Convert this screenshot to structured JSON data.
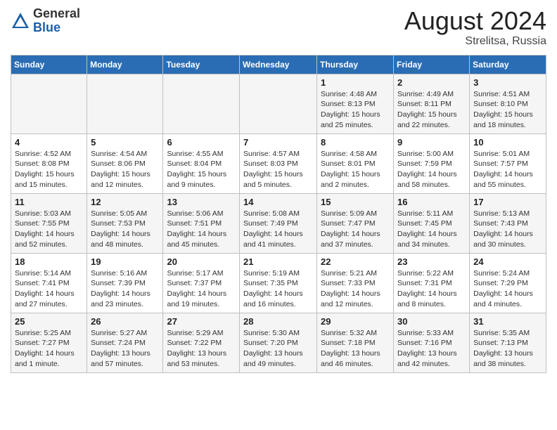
{
  "header": {
    "logo_general": "General",
    "logo_blue": "Blue",
    "month_year": "August 2024",
    "location": "Strelitsa, Russia"
  },
  "calendar": {
    "days_of_week": [
      "Sunday",
      "Monday",
      "Tuesday",
      "Wednesday",
      "Thursday",
      "Friday",
      "Saturday"
    ],
    "weeks": [
      [
        {
          "day": "",
          "detail": ""
        },
        {
          "day": "",
          "detail": ""
        },
        {
          "day": "",
          "detail": ""
        },
        {
          "day": "",
          "detail": ""
        },
        {
          "day": "1",
          "detail": "Sunrise: 4:48 AM\nSunset: 8:13 PM\nDaylight: 15 hours\nand 25 minutes."
        },
        {
          "day": "2",
          "detail": "Sunrise: 4:49 AM\nSunset: 8:11 PM\nDaylight: 15 hours\nand 22 minutes."
        },
        {
          "day": "3",
          "detail": "Sunrise: 4:51 AM\nSunset: 8:10 PM\nDaylight: 15 hours\nand 18 minutes."
        }
      ],
      [
        {
          "day": "4",
          "detail": "Sunrise: 4:52 AM\nSunset: 8:08 PM\nDaylight: 15 hours\nand 15 minutes."
        },
        {
          "day": "5",
          "detail": "Sunrise: 4:54 AM\nSunset: 8:06 PM\nDaylight: 15 hours\nand 12 minutes."
        },
        {
          "day": "6",
          "detail": "Sunrise: 4:55 AM\nSunset: 8:04 PM\nDaylight: 15 hours\nand 9 minutes."
        },
        {
          "day": "7",
          "detail": "Sunrise: 4:57 AM\nSunset: 8:03 PM\nDaylight: 15 hours\nand 5 minutes."
        },
        {
          "day": "8",
          "detail": "Sunrise: 4:58 AM\nSunset: 8:01 PM\nDaylight: 15 hours\nand 2 minutes."
        },
        {
          "day": "9",
          "detail": "Sunrise: 5:00 AM\nSunset: 7:59 PM\nDaylight: 14 hours\nand 58 minutes."
        },
        {
          "day": "10",
          "detail": "Sunrise: 5:01 AM\nSunset: 7:57 PM\nDaylight: 14 hours\nand 55 minutes."
        }
      ],
      [
        {
          "day": "11",
          "detail": "Sunrise: 5:03 AM\nSunset: 7:55 PM\nDaylight: 14 hours\nand 52 minutes."
        },
        {
          "day": "12",
          "detail": "Sunrise: 5:05 AM\nSunset: 7:53 PM\nDaylight: 14 hours\nand 48 minutes."
        },
        {
          "day": "13",
          "detail": "Sunrise: 5:06 AM\nSunset: 7:51 PM\nDaylight: 14 hours\nand 45 minutes."
        },
        {
          "day": "14",
          "detail": "Sunrise: 5:08 AM\nSunset: 7:49 PM\nDaylight: 14 hours\nand 41 minutes."
        },
        {
          "day": "15",
          "detail": "Sunrise: 5:09 AM\nSunset: 7:47 PM\nDaylight: 14 hours\nand 37 minutes."
        },
        {
          "day": "16",
          "detail": "Sunrise: 5:11 AM\nSunset: 7:45 PM\nDaylight: 14 hours\nand 34 minutes."
        },
        {
          "day": "17",
          "detail": "Sunrise: 5:13 AM\nSunset: 7:43 PM\nDaylight: 14 hours\nand 30 minutes."
        }
      ],
      [
        {
          "day": "18",
          "detail": "Sunrise: 5:14 AM\nSunset: 7:41 PM\nDaylight: 14 hours\nand 27 minutes."
        },
        {
          "day": "19",
          "detail": "Sunrise: 5:16 AM\nSunset: 7:39 PM\nDaylight: 14 hours\nand 23 minutes."
        },
        {
          "day": "20",
          "detail": "Sunrise: 5:17 AM\nSunset: 7:37 PM\nDaylight: 14 hours\nand 19 minutes."
        },
        {
          "day": "21",
          "detail": "Sunrise: 5:19 AM\nSunset: 7:35 PM\nDaylight: 14 hours\nand 16 minutes."
        },
        {
          "day": "22",
          "detail": "Sunrise: 5:21 AM\nSunset: 7:33 PM\nDaylight: 14 hours\nand 12 minutes."
        },
        {
          "day": "23",
          "detail": "Sunrise: 5:22 AM\nSunset: 7:31 PM\nDaylight: 14 hours\nand 8 minutes."
        },
        {
          "day": "24",
          "detail": "Sunrise: 5:24 AM\nSunset: 7:29 PM\nDaylight: 14 hours\nand 4 minutes."
        }
      ],
      [
        {
          "day": "25",
          "detail": "Sunrise: 5:25 AM\nSunset: 7:27 PM\nDaylight: 14 hours\nand 1 minute."
        },
        {
          "day": "26",
          "detail": "Sunrise: 5:27 AM\nSunset: 7:24 PM\nDaylight: 13 hours\nand 57 minutes."
        },
        {
          "day": "27",
          "detail": "Sunrise: 5:29 AM\nSunset: 7:22 PM\nDaylight: 13 hours\nand 53 minutes."
        },
        {
          "day": "28",
          "detail": "Sunrise: 5:30 AM\nSunset: 7:20 PM\nDaylight: 13 hours\nand 49 minutes."
        },
        {
          "day": "29",
          "detail": "Sunrise: 5:32 AM\nSunset: 7:18 PM\nDaylight: 13 hours\nand 46 minutes."
        },
        {
          "day": "30",
          "detail": "Sunrise: 5:33 AM\nSunset: 7:16 PM\nDaylight: 13 hours\nand 42 minutes."
        },
        {
          "day": "31",
          "detail": "Sunrise: 5:35 AM\nSunset: 7:13 PM\nDaylight: 13 hours\nand 38 minutes."
        }
      ]
    ]
  }
}
